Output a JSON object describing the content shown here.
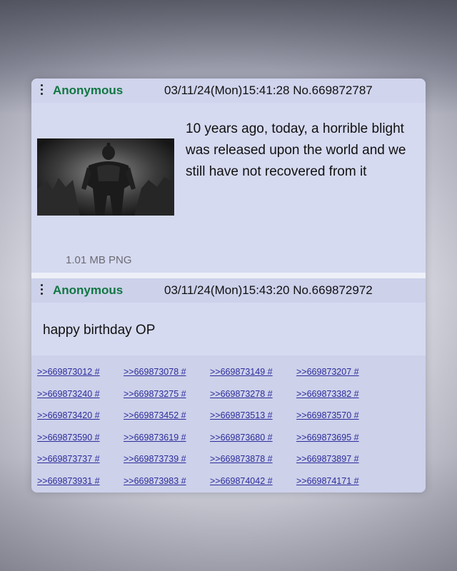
{
  "post1": {
    "name": "Anonymous",
    "meta": "03/11/24(Mon)15:41:28 No.669872787",
    "body": "10 years ago, today, a horrible blight was released upon the world and we still have not recovered from it",
    "file_info": "1.01 MB PNG"
  },
  "post2": {
    "name": "Anonymous",
    "meta": "03/11/24(Mon)15:43:20 No.669872972",
    "body": "happy birthday OP"
  },
  "replies": [
    [
      ">>669873012 #",
      ">>669873078 #",
      ">>669873149 #",
      ">>669873207 #"
    ],
    [
      ">>669873240 #",
      ">>669873275 #",
      ">>669873278 #",
      ">>669873382 #"
    ],
    [
      ">>669873420 #",
      ">>669873452 #",
      ">>669873513 #",
      ">>669873570 #"
    ],
    [
      ">>669873590 #",
      ">>669873619 #",
      ">>669873680 #",
      ">>669873695 #"
    ],
    [
      ">>669873737 #",
      ">>669873739 #",
      ">>669873878 #",
      ">>669873897 #"
    ],
    [
      ">>669873931 #",
      ">>669873983 #",
      ">>669874042 #",
      ">>669874171 #"
    ]
  ],
  "colors": {
    "post_background": "#d6daf0",
    "name": "#117743",
    "link": "#2c2c9a"
  },
  "icons": {
    "post_menu": "vertical-ellipsis-icon",
    "thumbnail": "armored-knight-image"
  }
}
